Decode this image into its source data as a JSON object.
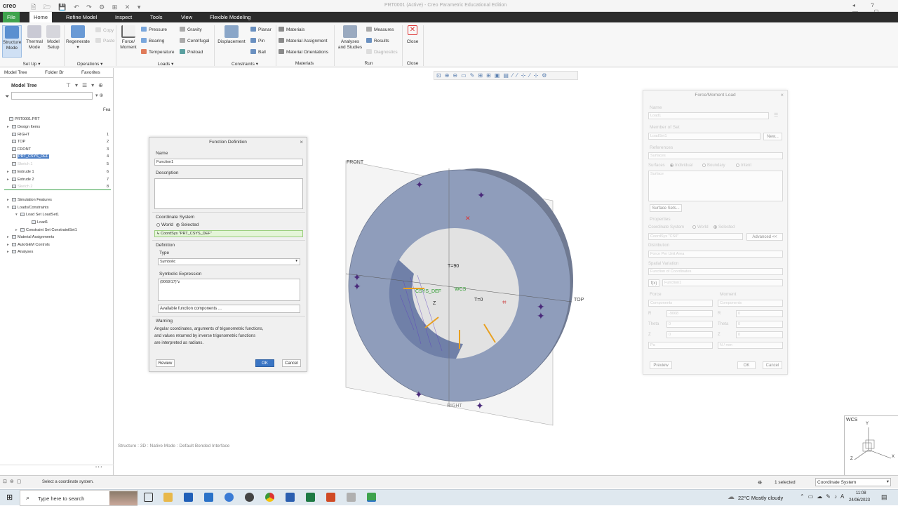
{
  "app": {
    "logo": "creo",
    "window_title": "PRT0001 (Active) - Creo Parametric Educational Edition",
    "quick_access": "🗎 🗁 💾 ↶ ↷ ⚙ ⊞ ✕ ▾"
  },
  "tabs": [
    {
      "label": "File"
    },
    {
      "label": "Home"
    },
    {
      "label": "Refine Model"
    },
    {
      "label": "Inspect"
    },
    {
      "label": "Tools"
    },
    {
      "label": "View"
    },
    {
      "label": "Flexible Modeling"
    }
  ],
  "ribbon": {
    "setup": {
      "structure": "Structure Mode",
      "thermal": "Thermal Mode",
      "model_setup": "Model Setup",
      "group": "Set Up"
    },
    "operations": {
      "regenerate": "Regenerate",
      "copy": "Copy",
      "paste": "Paste",
      "group": "Operations"
    },
    "loads": {
      "force_moment": "Force/ Moment",
      "pressure": "Pressure",
      "bearing": "Bearing",
      "temperature": "Temperature",
      "gravity": "Gravity",
      "centrifugal": "Centrifugal",
      "preload": "Preload",
      "group": "Loads"
    },
    "constraints": {
      "displacement": "Displacement",
      "planar": "Planar",
      "pin": "Pin",
      "ball": "Ball",
      "group": "Constraints"
    },
    "materials": {
      "materials": "Materials",
      "assignment": "Material Assignment",
      "orientations": "Material Orientations",
      "group": "Materials"
    },
    "run": {
      "analyses": "Analyses and Studies",
      "measures": "Measures",
      "results": "Results",
      "diagnostics": "Diagnostics",
      "group": "Run"
    },
    "close": {
      "close": "Close",
      "group": "Close"
    }
  },
  "left_panel": {
    "tabs": [
      "Model Tree",
      "Folder Br",
      "Favorites"
    ],
    "title": "Model Tree",
    "col": "Fea",
    "tree": [
      {
        "label": "PRT0001.PRT",
        "num": ""
      },
      {
        "label": "Design Items",
        "num": ""
      },
      {
        "label": "RIGHT",
        "num": "1"
      },
      {
        "label": "TOP",
        "num": "2"
      },
      {
        "label": "FRONT",
        "num": "3"
      },
      {
        "label": "PRT_CSYS_DEF",
        "num": "4"
      },
      {
        "label": "Sketch 1",
        "num": "5"
      },
      {
        "label": "Extrude 1",
        "num": "6"
      },
      {
        "label": "Extrude 2",
        "num": "7"
      },
      {
        "label": "Sketch 2",
        "num": "8"
      },
      {
        "label": "Simulation Features",
        "num": ""
      },
      {
        "label": "Loads/Constraints",
        "num": ""
      },
      {
        "label": "Load Set LoadSet1",
        "num": ""
      },
      {
        "label": "Load1",
        "num": ""
      },
      {
        "label": "Constraint Set ConstraintSet1",
        "num": ""
      },
      {
        "label": "Material Assignments",
        "num": ""
      },
      {
        "label": "AutoGEM Controls",
        "num": ""
      },
      {
        "label": "Analyses",
        "num": ""
      }
    ]
  },
  "function_dialog": {
    "title": "Function Definition",
    "name_label": "Name",
    "name_value": "Function1",
    "description_label": "Description",
    "cs_label": "Coordinate System",
    "world": "World",
    "selected": "Selected",
    "cs_value": "CoordSys \"PRT_CSYS_DEF\"",
    "definition_label": "Definition",
    "type_label": "Type",
    "type_value": "Symbolic",
    "symexpr_label": "Symbolic Expression",
    "symexpr_value": "(9068/17)*z",
    "available": "Available function components ...",
    "warning_label": "Warning",
    "warning_text": [
      "Angular coordinates, arguments of trigonometric functions,",
      "and values returned by inverse trigonometric functions",
      "are interpreted as radians."
    ],
    "review": "Review",
    "ok": "OK",
    "cancel": "Cancel"
  },
  "force_dialog": {
    "title": "Force/Moment Load",
    "name_label": "Name",
    "name_value": "Load1",
    "member_label": "Member of Set",
    "member_value": "LoadSet1",
    "new": "New...",
    "references_label": "References",
    "ref_type": "Surfaces",
    "surfaces_label": "Surfaces",
    "individual": "Individual",
    "boundary": "Boundary",
    "intent": "Intent",
    "surface_item": "Surface",
    "surface_sets": "Surface Sets...",
    "properties_label": "Properties",
    "cs_label": "Coordinate System",
    "world": "World",
    "selected": "Selected",
    "cs_value": "CoordSys \"CS0\"",
    "advanced": "Advanced <<",
    "distribution_label": "Distribution",
    "distribution_value": "Force Per Unit Area",
    "spatial_label": "Spatial Variation",
    "spatial_value": "Function of Coordinates",
    "fx": "f(x)",
    "function_value": "Function1",
    "force_label": "Force",
    "moment_label": "Moment",
    "components": "Components",
    "force_rows": [
      {
        "k": "R",
        "v": "-9068"
      },
      {
        "k": "Theta",
        "v": "0"
      },
      {
        "k": "Z",
        "v": "0"
      }
    ],
    "moment_rows": [
      {
        "k": "R",
        "v": "0"
      },
      {
        "k": "Theta",
        "v": "0"
      },
      {
        "k": "Z",
        "v": "0"
      }
    ],
    "force_unit": "Pa",
    "moment_unit": "N / mm",
    "preview": "Preview",
    "ok": "OK",
    "cancel": "Cancel"
  },
  "model": {
    "front": "FRONT",
    "top": "TOP",
    "right": "RIGHT",
    "t90": "T=90",
    "t0": "T=0",
    "csys": "CSYS_DEF",
    "wcs": "WCS",
    "z": "Z"
  },
  "viewport": {
    "footer": "Structure : 3D : Native Mode : Default Bonded Interface",
    "triad_wcs": "WCS",
    "triad_y": "Y",
    "triad_z": "Z",
    "triad_x": "X"
  },
  "status": {
    "message": "Select a coordinate system.",
    "selected": "1 selected",
    "filter": "Coordinate System"
  },
  "taskbar": {
    "search": "Type here to search",
    "weather": "22°C  Mostly cloudy",
    "time": "11:08",
    "date": "24/06/2023"
  },
  "colors": {
    "accent": "#3a75c4",
    "file_tab": "#3fa34d",
    "ring": "#8f9dbb",
    "load_arrow": "#e8a020"
  }
}
